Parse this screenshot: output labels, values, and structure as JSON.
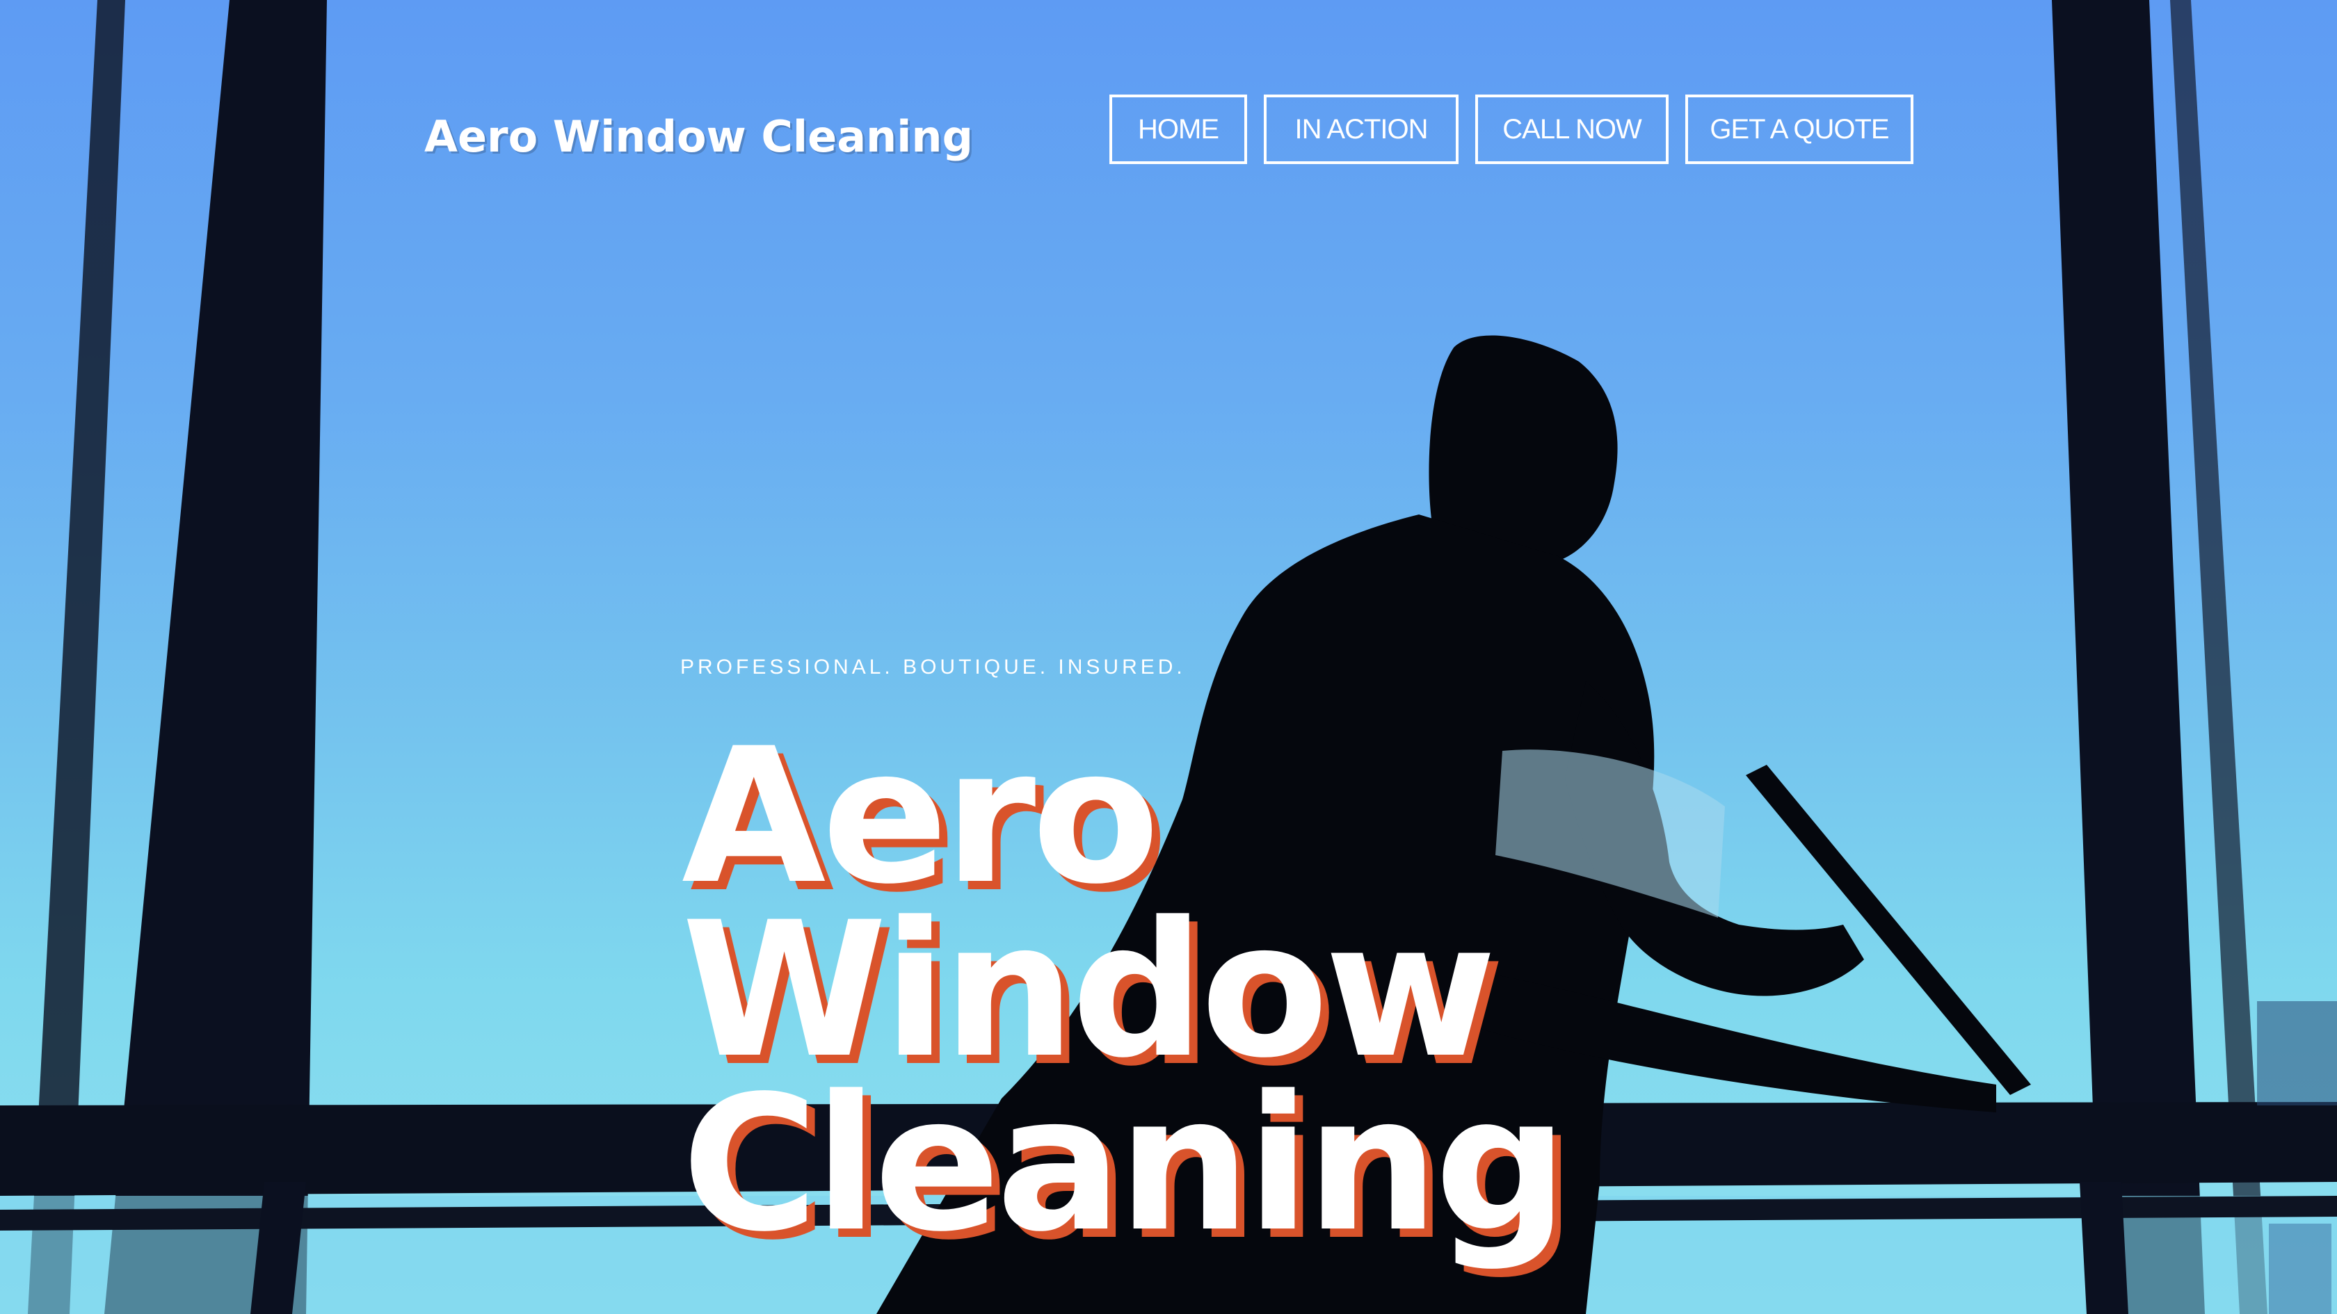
{
  "site": {
    "brand": "Aero Window Cleaning"
  },
  "nav": {
    "items": [
      "HOME",
      "IN ACTION",
      "CALL NOW",
      "GET A QUOTE"
    ]
  },
  "hero": {
    "tagline": "PROFESSIONAL. BOUTIQUE. INSURED.",
    "headline_lines": [
      "Aero",
      "Window",
      "Cleaning"
    ],
    "background_image": "silhouette-window-cleaner-photo"
  },
  "colors": {
    "sky_top": "#5e9bf3",
    "sky_bottom": "#8fe0f0",
    "frame": "#0a0f1e",
    "headline_text": "#ffffff",
    "headline_shadow": "#d9532b",
    "nav_border": "#ffffff"
  }
}
